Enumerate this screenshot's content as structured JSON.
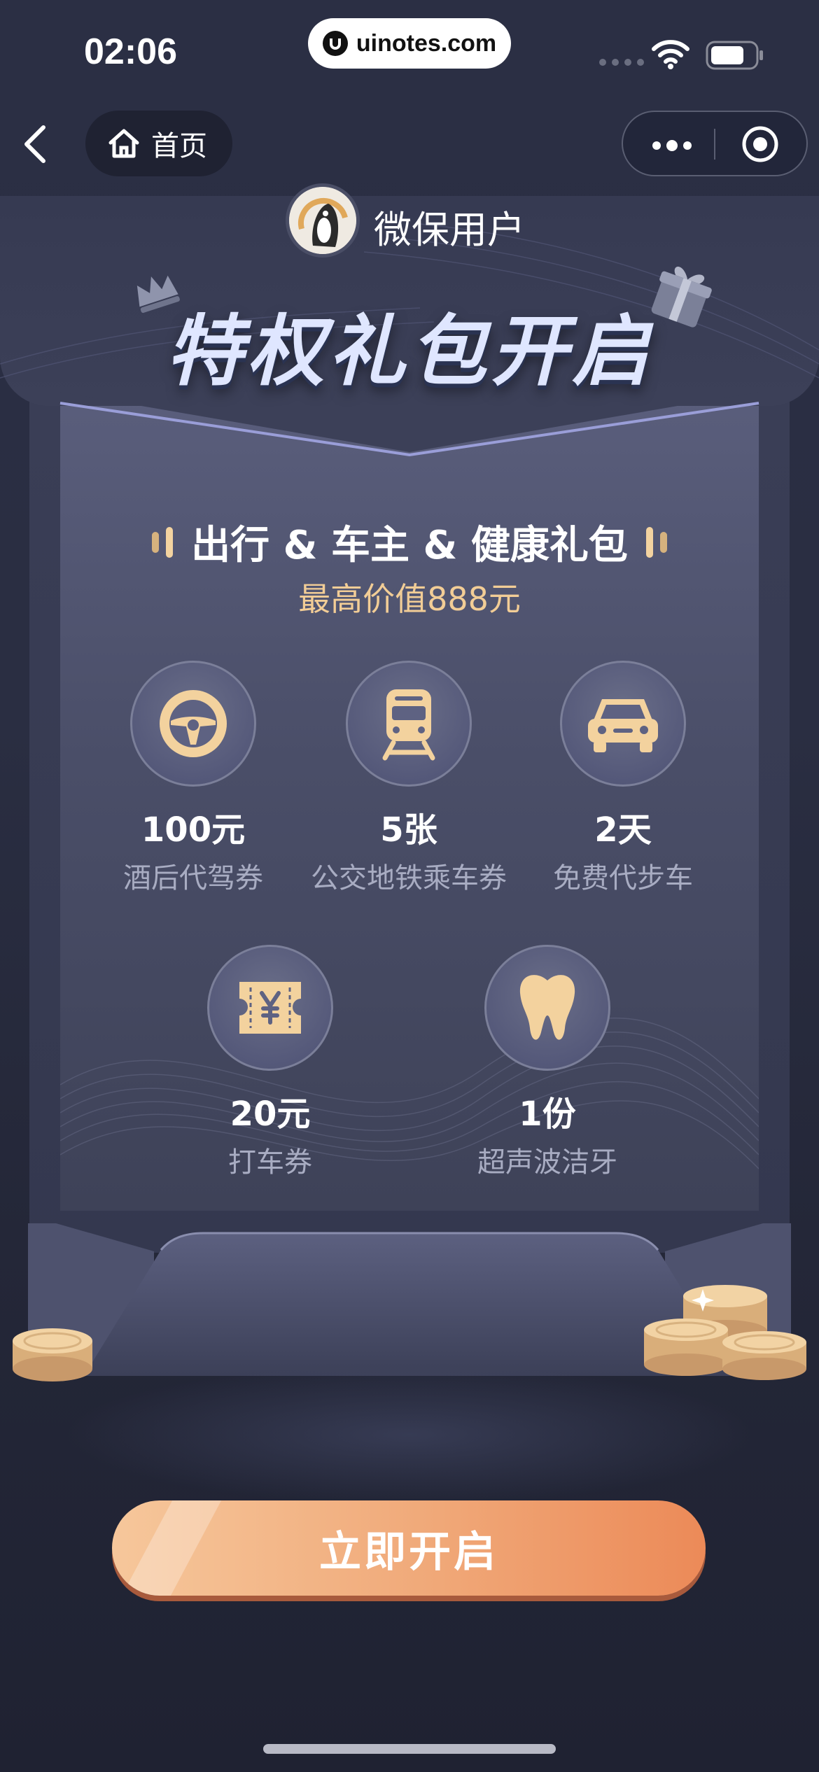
{
  "status_bar": {
    "time": "02:06",
    "url": "uinotes.com",
    "icons": [
      "signal-icon",
      "wifi-icon",
      "battery-icon"
    ]
  },
  "nav": {
    "back_icon": "chevron-left-icon",
    "home_icon": "home-icon",
    "home_label": "首页",
    "more_icon": "more-dots-icon",
    "close_icon": "target-circle-icon"
  },
  "header": {
    "username": "微保用户",
    "headline": "特权礼包开启",
    "decor_icons": [
      "crown-icon",
      "gift-icon"
    ]
  },
  "package": {
    "title": "出行 & 车主 & 健康礼包",
    "subtitle": "最高价值888元"
  },
  "benefits": [
    {
      "icon": "steering-wheel-icon",
      "amount": "100元",
      "desc": "酒后代驾券"
    },
    {
      "icon": "train-icon",
      "amount": "5张",
      "desc": "公交地铁乘车券"
    },
    {
      "icon": "car-icon",
      "amount": "2天",
      "desc": "免费代步车"
    },
    {
      "icon": "ticket-yen-icon",
      "amount": "20元",
      "desc": "打车券"
    },
    {
      "icon": "tooth-icon",
      "amount": "1份",
      "desc": "超声波洁牙"
    }
  ],
  "cta": {
    "label": "立即开启"
  },
  "colors": {
    "background": "#2a2e42",
    "accent_gold": "#f2cd96",
    "cta_start": "#f6c79b",
    "cta_end": "#ec8a58",
    "text_muted": "#a8acc2"
  }
}
